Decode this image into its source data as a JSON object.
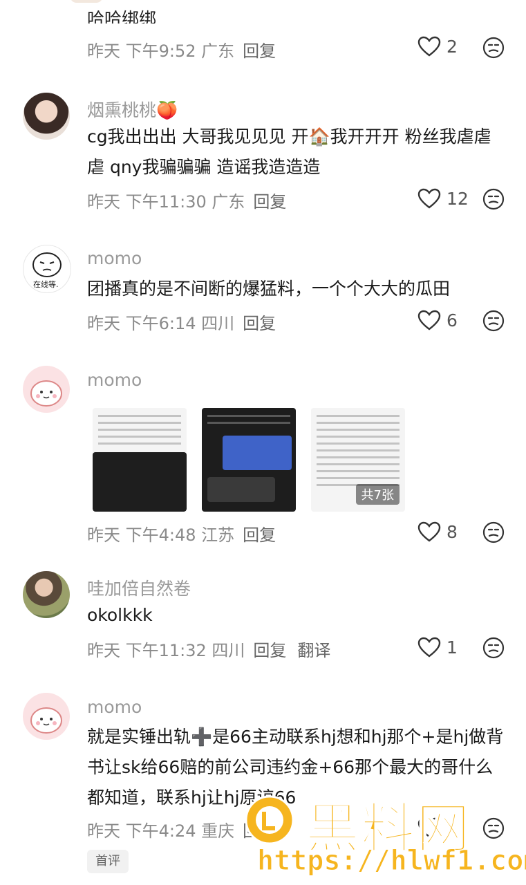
{
  "top_partial": {
    "text": "哈哈绑绑",
    "meta": "昨天 下午9:52 广东",
    "reply": "回复",
    "likes": "2"
  },
  "comments": [
    {
      "username": "烟熏桃桃🍑",
      "text": "cg我出出出 大哥我见见见 开🏠我开开开 粉丝我虐虐虐 qny我骗骗骗 造谣我造造造",
      "meta": "昨天 下午11:30 广东",
      "reply": "回复",
      "likes": "12"
    },
    {
      "username": "momo",
      "avatar_caption": "在线等.",
      "text": "团播真的是不间断的爆猛料，一个个大大的瓜田",
      "meta": "昨天 下午6:14 四川",
      "reply": "回复",
      "likes": "6"
    },
    {
      "username": "momo",
      "images_more": "共7张",
      "meta": "昨天 下午4:48 江苏",
      "reply": "回复",
      "likes": "8"
    },
    {
      "username": "哇加倍自然卷",
      "text": "okolkkk",
      "meta": "昨天 下午11:32 四川",
      "reply": "回复",
      "translate": "翻译",
      "likes": "1"
    },
    {
      "username": "momo",
      "text": "就是实锤出轨➕是66主动联系hj想和hj那个+是hj做背书让sk给66赔的前公司违约金+66那个最大的哥什么都知道，联系hj让hj原谅66",
      "meta": "昨天 下午4:24 重庆",
      "reply": "回复",
      "likes": "3"
    }
  ],
  "first_comment_tag": "首评",
  "watermark": {
    "title": "黑料网",
    "url": "https://hlwf1.com"
  },
  "icons": {
    "like": "heart-icon",
    "reaction": "emoji-face-icon"
  },
  "colors": {
    "meta_text": "#8a8a8a",
    "username": "#9a9a9a",
    "watermark": "#f6b51f"
  }
}
